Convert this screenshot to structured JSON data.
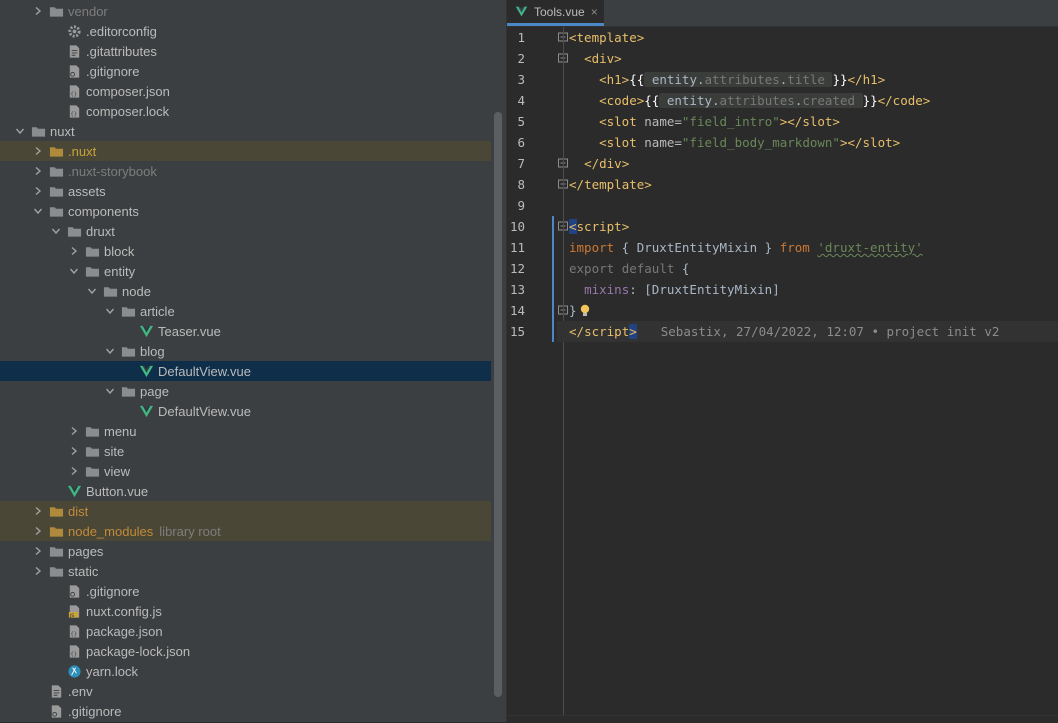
{
  "tree": {
    "items": [
      {
        "label": "vendor",
        "kind": "folder",
        "indent": 1,
        "arrow": "right",
        "style": "dim"
      },
      {
        "label": ".editorconfig",
        "kind": "gear",
        "indent": 2
      },
      {
        "label": ".gitattributes",
        "kind": "text",
        "indent": 2
      },
      {
        "label": ".gitignore",
        "kind": "gitignore",
        "indent": 2
      },
      {
        "label": "composer.json",
        "kind": "json",
        "indent": 2
      },
      {
        "label": "composer.lock",
        "kind": "json",
        "indent": 2
      },
      {
        "label": "nuxt",
        "kind": "folder",
        "indent": 0,
        "arrow": "down"
      },
      {
        "label": ".nuxt",
        "kind": "folder-orange",
        "indent": 1,
        "arrow": "right",
        "style": "yellow",
        "row": "excluded"
      },
      {
        "label": ".nuxt-storybook",
        "kind": "folder",
        "indent": 1,
        "arrow": "right",
        "style": "dim"
      },
      {
        "label": "assets",
        "kind": "folder",
        "indent": 1,
        "arrow": "right"
      },
      {
        "label": "components",
        "kind": "folder",
        "indent": 1,
        "arrow": "down"
      },
      {
        "label": "druxt",
        "kind": "folder",
        "indent": 2,
        "arrow": "down"
      },
      {
        "label": "block",
        "kind": "folder",
        "indent": 3,
        "arrow": "right"
      },
      {
        "label": "entity",
        "kind": "folder",
        "indent": 3,
        "arrow": "down"
      },
      {
        "label": "node",
        "kind": "folder",
        "indent": 4,
        "arrow": "down"
      },
      {
        "label": "article",
        "kind": "folder",
        "indent": 5,
        "arrow": "down"
      },
      {
        "label": "Teaser.vue",
        "kind": "vue",
        "indent": 6
      },
      {
        "label": "blog",
        "kind": "folder",
        "indent": 5,
        "arrow": "down"
      },
      {
        "label": "DefaultView.vue",
        "kind": "vue",
        "indent": 6,
        "row": "selected"
      },
      {
        "label": "page",
        "kind": "folder",
        "indent": 5,
        "arrow": "down"
      },
      {
        "label": "DefaultView.vue",
        "kind": "vue",
        "indent": 6
      },
      {
        "label": "menu",
        "kind": "folder",
        "indent": 3,
        "arrow": "right"
      },
      {
        "label": "site",
        "kind": "folder",
        "indent": 3,
        "arrow": "right"
      },
      {
        "label": "view",
        "kind": "folder",
        "indent": 3,
        "arrow": "right"
      },
      {
        "label": "Button.vue",
        "kind": "vue",
        "indent": 2
      },
      {
        "label": "dist",
        "kind": "folder-orange",
        "indent": 1,
        "arrow": "right",
        "style": "orange",
        "row": "excluded"
      },
      {
        "label": "node_modules",
        "kind": "folder-orange",
        "indent": 1,
        "arrow": "right",
        "style": "orange",
        "row": "excluded",
        "extra": "library root"
      },
      {
        "label": "pages",
        "kind": "folder",
        "indent": 1,
        "arrow": "right"
      },
      {
        "label": "static",
        "kind": "folder",
        "indent": 1,
        "arrow": "right"
      },
      {
        "label": ".gitignore",
        "kind": "gitignore",
        "indent": 2
      },
      {
        "label": "nuxt.config.js",
        "kind": "js",
        "indent": 2
      },
      {
        "label": "package.json",
        "kind": "json",
        "indent": 2
      },
      {
        "label": "package-lock.json",
        "kind": "json",
        "indent": 2
      },
      {
        "label": "yarn.lock",
        "kind": "yarn",
        "indent": 2
      },
      {
        "label": ".env",
        "kind": "text",
        "indent": 1
      },
      {
        "label": ".gitignore",
        "kind": "gitignore",
        "indent": 1
      }
    ]
  },
  "editor": {
    "tab": {
      "label": "Tools.vue",
      "close": "×"
    },
    "line_numbers": [
      "1",
      "2",
      "3",
      "4",
      "5",
      "6",
      "7",
      "8",
      "9",
      "10",
      "11",
      "12",
      "13",
      "14",
      "15"
    ],
    "code": {
      "l1": {
        "lt": "<",
        "tag": "template",
        "gt": ">"
      },
      "l2": {
        "lt": "<",
        "tag": "div",
        "gt": ">"
      },
      "l3": {
        "open": "<h1>",
        "mopen": "{{",
        "obj": "entity",
        "dot1": ".",
        "p1": "attributes",
        "dot2": ".",
        "p2": "title",
        "mclose": "}}",
        "close": "</h1>"
      },
      "l4": {
        "open": "<code>",
        "mopen": "{{",
        "obj": "entity",
        "dot1": ".",
        "p1": "attributes",
        "dot2": ".",
        "p2": "created",
        "mclose": "}}",
        "close": "</code>"
      },
      "l5": {
        "open": "<slot ",
        "attr": "name=",
        "val": "\"field_intro\"",
        "close": "></slot>"
      },
      "l6": {
        "open": "<slot ",
        "attr": "name=",
        "val": "\"field_body_markdown\"",
        "close": "></slot>"
      },
      "l7": {
        "text": "</div>"
      },
      "l8": {
        "lt": "</",
        "tag": "template",
        "gt": ">"
      },
      "l10": {
        "lt": "<",
        "tag": "script",
        "gt": ">"
      },
      "l11": {
        "kw1": "import",
        "mid": " { DruxtEntityMixin } ",
        "kw2": "from",
        "str": "'druxt-entity'"
      },
      "l12": {
        "kw1": "export",
        "kw2": "default",
        "rest": " {"
      },
      "l13": {
        "prop": "mixins",
        "rest": ": [DruxtEntityMixin]"
      },
      "l14": {
        "text": "}"
      },
      "l15": {
        "lt": "</",
        "tag": "script",
        "gt": ">",
        "blame": "Sebastix, 27/04/2022, 12:07 • project init v2"
      }
    }
  },
  "colors": {
    "folder": "#8a8d8f",
    "folder_orange": "#b08a3c",
    "vue": "#41b883",
    "accent": "#4a88c7"
  }
}
